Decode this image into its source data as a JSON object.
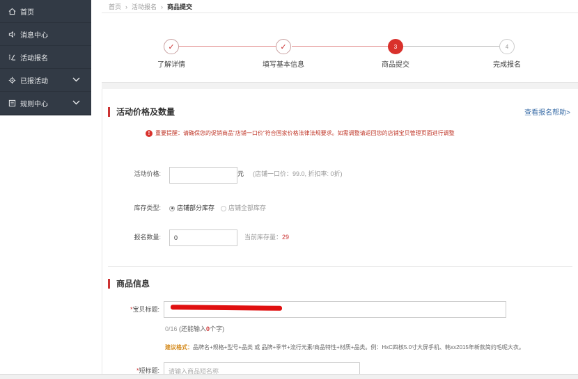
{
  "sidebar": {
    "items": [
      {
        "label": "首页",
        "icon": "home-icon"
      },
      {
        "label": "消息中心",
        "icon": "speaker-icon"
      },
      {
        "label": "活动报名",
        "icon": "list-edit-icon"
      },
      {
        "label": "已报活动",
        "icon": "gear-icon",
        "expandable": true
      },
      {
        "label": "规则中心",
        "icon": "document-icon",
        "expandable": true
      }
    ]
  },
  "breadcrumb": {
    "items": [
      "首页",
      "活动报名",
      "商品提交"
    ]
  },
  "steps": [
    {
      "label": "了解详情",
      "state": "done",
      "mark": "✓"
    },
    {
      "label": "填写基本信息",
      "state": "done",
      "mark": "✓"
    },
    {
      "label": "商品提交",
      "state": "active",
      "mark": "3"
    },
    {
      "label": "完成报名",
      "state": "todo",
      "mark": "4"
    }
  ],
  "price_section": {
    "title": "活动价格及数量",
    "help_link": "查看报名帮助>",
    "notice": "重要提醒：请确保您的促销商品\"店铺一口价\"符合国家价格法律法规要求。如需调整请返回您的店铺宝贝管理页面进行调整",
    "price_label": "活动价格:",
    "price_value": "",
    "price_unit": "元",
    "price_hint": "(店铺一口价：99.0, 折扣率: 0折)",
    "stock_label": "库存类型:",
    "stock_options": [
      "店铺部分库存",
      "店铺全部库存"
    ],
    "qty_label": "报名数量:",
    "qty_value": "0",
    "stock_hint_prefix": "当前库存量：",
    "stock_hint_value": "29"
  },
  "product_section": {
    "title": "商品信息",
    "title_label": "宝贝标题:",
    "char_count": "0/16",
    "char_hint_prefix": "(还能输入",
    "char_hint_value": "0",
    "char_hint_suffix": "个字)",
    "suggest_label": "建议格式：",
    "suggest_text": "品牌名+规格+型号+品类 或 品牌+季节+流行元素/商品特性+材质+品类。例：HxC四核5.0寸大屏手机、韩xx2015年新款简约毛呢大衣。",
    "short_label": "短标题:",
    "short_placeholder": "请输入商品短名称"
  },
  "colors": {
    "sidebar_bg": "#323a45",
    "accent": "#d9312c",
    "link": "#3d6fa8"
  }
}
